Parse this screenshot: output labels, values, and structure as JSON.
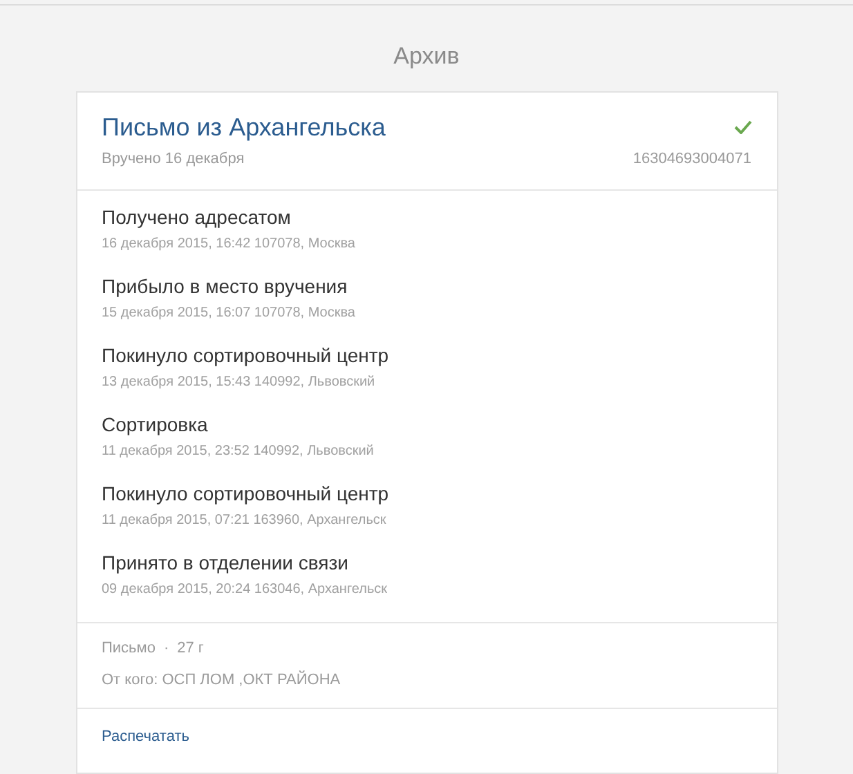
{
  "page": {
    "title": "Архив"
  },
  "item": {
    "title": "Письмо из Архангельска",
    "subtitle": "Вручено 16 декабря",
    "delivered": true,
    "barcode": "16304693004071"
  },
  "events": [
    {
      "status": "Получено адресатом",
      "details": "16 декабря 2015, 16:42 107078, Москва"
    },
    {
      "status": "Прибыло в место вручения",
      "details": "15 декабря 2015, 16:07 107078, Москва"
    },
    {
      "status": "Покинуло сортировочный центр",
      "details": "13 декабря 2015, 15:43 140992, Львовский"
    },
    {
      "status": "Сортировка",
      "details": "11 декабря 2015, 23:52 140992, Львовский"
    },
    {
      "status": "Покинуло сортировочный центр",
      "details": "11 декабря 2015, 07:21 163960, Архангельск"
    },
    {
      "status": "Принято в отделении связи",
      "details": "09 декабря 2015, 20:24 163046, Архангельск"
    }
  ],
  "info": {
    "type": "Письмо",
    "separator": "·",
    "weight": "27 г",
    "sender": "От кого: ОСП ЛОМ ,ОКТ РАЙОНА"
  },
  "actions": {
    "print": "Распечатать"
  }
}
